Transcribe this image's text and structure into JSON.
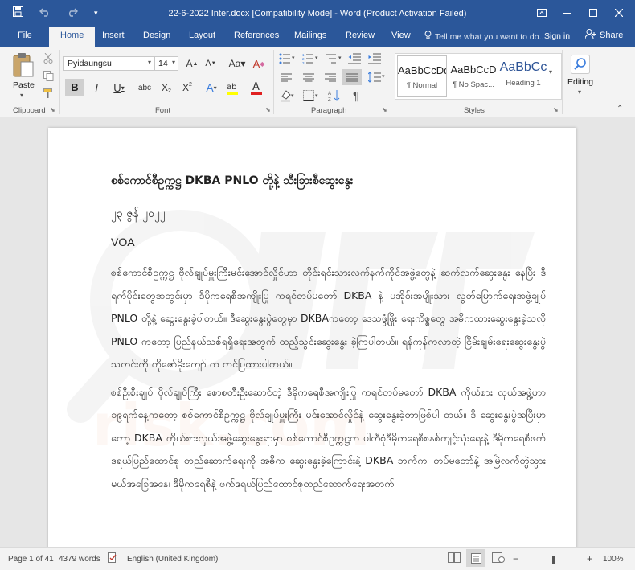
{
  "window": {
    "title": "22-6-2022 Inter.docx [Compatibility Mode] - Word (Product Activation Failed)",
    "qat_icons": [
      "save-icon",
      "undo-icon",
      "redo-icon",
      "customize-qat-icon"
    ],
    "controls": [
      "ribbon-display-options-icon",
      "minimize-icon",
      "maximize-icon",
      "close-icon"
    ]
  },
  "tabs": [
    "File",
    "Home",
    "Insert",
    "Design",
    "Layout",
    "References",
    "Mailings",
    "Review",
    "View"
  ],
  "active_tab": "Home",
  "tellme": {
    "placeholder": "Tell me what you want to do..."
  },
  "account": {
    "signin": "Sign in",
    "share": "Share"
  },
  "ribbon": {
    "clipboard": {
      "label": "Clipboard",
      "paste": "Paste"
    },
    "font": {
      "label": "Font",
      "name": "Pyidaungsu",
      "size": "14"
    },
    "paragraph": {
      "label": "Paragraph"
    },
    "styles": {
      "label": "Styles",
      "items": [
        {
          "preview": "AaBbCcDd",
          "name": "¶ Normal"
        },
        {
          "preview": "AaBbCcD",
          "name": "¶ No Spac..."
        },
        {
          "preview": "AaBbCc",
          "name": "Heading 1"
        }
      ]
    },
    "editing": {
      "label": "Editing"
    }
  },
  "document": {
    "title": "စစ်ကောင်စီဥက္ကဋ္ဌ DKBA PNLO တို့နဲ့ သီးခြားစီဆွေးနွေး",
    "date": "၂၃ ဇွန် ၂၀၂၂",
    "source": "VOA",
    "paragraphs": [
      "စစ်ကောင်စီဥက္ကဋ္ဌ ဗိုလ်ချုပ်မှူးကြီးမင်းအောင်လှိုင်ဟာ တိုင်းရင်းသားလက်နက်ကိုင်အဖွဲ့တွေနဲ့ ဆက်လက်ဆွေးနွေး နေပြီး ဒီရက်ပိုင်းတွေအတွင်းမှာ ဒီမိုကရေစီအကျိုးပြု ကရင်တပ်မတော် DKBA နဲ့ ပအိုဝ်းအမျိုးသား လွတ်မြောက်ရေးအဖွဲ့ချုပ် PNLO တို့နဲ့ ဆွေးနွေးခဲ့ပါတယ်။ ဒီဆွေးနွေးပွဲတွေမှာ DKBAကတော့ ဒေသဖွံ့ဖြိုး ရေးကိစ္စတွေ အဓိကထားဆွေးနွေးခဲ့သလို PNLO ကတော့ ပြည်နယ်သစ်ရရှိရေးအတွက် ထည့်သွင်းဆွေးနွေး ခဲ့ကြပါတယ်။ ရန်ကုန်ကလာတဲ့ ငြိမ်းချမ်းရေးဆွေးနွေးပွဲသတင်းကို ကိုဇော်မိုးကျော် က တင်ပြထားပါတယ်။",
      "စစ်ဦးစီးချုပ် ဗိုလ်ချုပ်ကြီး စောစတီးဦးဆောင်တဲ့ ဒီမိုကရေစီအကျိုးပြု ကရင်တပ်မတော် DKBA ကိုယ်စား လှယ်အဖွဲ့ဟာ ၁၉ရက်နေ့ကတော့ စစ်ကောင်စီဥက္ကဋ္ဌ ဗိုလ်ချုပ်မှူးကြီး မင်းအောင်လှိုင်နဲ့ ဆွေးနွေးခဲ့တာဖြစ်ပါ တယ်။ ဒီ ဆွေးနွေးပွဲအပြီးမှာတော့ DKBA ကိုယ်စားလှယ်အဖွဲ့ဆွေးနွေးရာမှာ စစ်ကောင်စီဥက္ကဋ္ဌက ပါတီစုံဒီမိုကရေစီစနစ်ကျင့်သုံးရေးနဲ့ ဒီမိုကရေစီဖက်ဒရယ်ပြည်ထောင်စု တည်ဆောက်ရေးကို အဓိက ဆွေးနွေးခဲ့ကြောင်းနဲ့ DKBA ဘက်က၊ တပ်မတော်နဲ့ အမြဲလက်တွဲသွားမယ်အခြေအနေ၊ ဒီမိုကရေစီနဲ့ ဖက်ဒရယ်ပြည်ထောင်စုတည်ဆောက်ရေးအတက်"
    ]
  },
  "status": {
    "page": "Page 1 of 41",
    "words": "4379 words",
    "language": "English (United Kingdom)",
    "zoom": "100%",
    "zoom_level": 1.0
  },
  "colors": {
    "accent": "#2b579a",
    "ribbon_bg": "#f3f3f3",
    "doc_bg": "#e6e6e6"
  }
}
